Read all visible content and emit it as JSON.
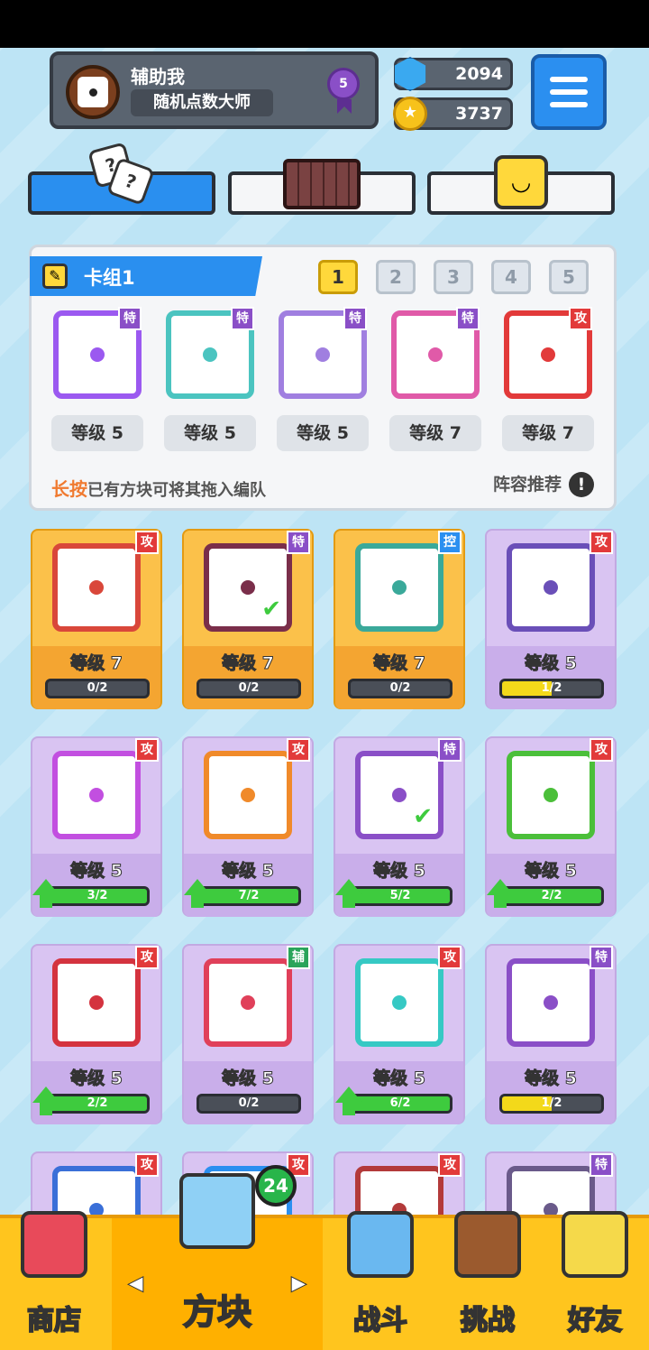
{
  "profile": {
    "name": "辅助我",
    "title": "随机点数大师",
    "rank": "5"
  },
  "currency": {
    "gems": "2094",
    "coins": "3737"
  },
  "deck": {
    "title": "卡组1",
    "pages": [
      "1",
      "2",
      "3",
      "4",
      "5"
    ],
    "active_page": "1",
    "slots": [
      {
        "tag": "特",
        "level": "等级 5",
        "color": "#9b59f0"
      },
      {
        "tag": "特",
        "level": "等级 5",
        "color": "#4bc4c0"
      },
      {
        "tag": "特",
        "level": "等级 5",
        "color": "#a07fe0"
      },
      {
        "tag": "特",
        "level": "等级 7",
        "color": "#e05aa8"
      },
      {
        "tag": "攻",
        "level": "等级 7",
        "color": "#e23a3a"
      }
    ],
    "hint_highlight": "长按",
    "hint_text": "已有方块可将其拖入编队",
    "recommend": "阵容推荐"
  },
  "collection": [
    {
      "tag": "攻",
      "level": "等级 7",
      "progress": "0/2",
      "fill": 0,
      "gold": true,
      "color": "#d9473a",
      "upgrade": false,
      "equipped": false
    },
    {
      "tag": "特",
      "level": "等级 7",
      "progress": "0/2",
      "fill": 0,
      "gold": true,
      "color": "#7a2e4a",
      "upgrade": false,
      "equipped": true
    },
    {
      "tag": "控",
      "level": "等级 7",
      "progress": "0/2",
      "fill": 0,
      "gold": true,
      "color": "#3aa99a",
      "upgrade": false,
      "equipped": false
    },
    {
      "tag": "攻",
      "level": "等级 5",
      "progress": "1/2",
      "fill": 0.5,
      "gold": false,
      "color": "#6a4fb8",
      "upgrade": false,
      "equipped": false,
      "yellow": true
    },
    {
      "tag": "攻",
      "level": "等级 5",
      "progress": "3/2",
      "fill": 1,
      "gold": false,
      "color": "#c24fe0",
      "upgrade": true,
      "equipped": false
    },
    {
      "tag": "攻",
      "level": "等级 5",
      "progress": "7/2",
      "fill": 1,
      "gold": false,
      "color": "#f08a2a",
      "upgrade": true,
      "equipped": false
    },
    {
      "tag": "特",
      "level": "等级 5",
      "progress": "5/2",
      "fill": 1,
      "gold": false,
      "color": "#8a4fc7",
      "upgrade": true,
      "equipped": true
    },
    {
      "tag": "攻",
      "level": "等级 5",
      "progress": "2/2",
      "fill": 1,
      "gold": false,
      "color": "#4bbf3a",
      "upgrade": true,
      "equipped": false
    },
    {
      "tag": "攻",
      "level": "等级 5",
      "progress": "2/2",
      "fill": 1,
      "gold": false,
      "color": "#d4333f",
      "upgrade": true,
      "equipped": false
    },
    {
      "tag": "辅",
      "level": "等级 5",
      "progress": "0/2",
      "fill": 0,
      "gold": false,
      "color": "#e0405a",
      "upgrade": false,
      "equipped": false
    },
    {
      "tag": "攻",
      "level": "等级 5",
      "progress": "6/2",
      "fill": 1,
      "gold": false,
      "color": "#36c9c4",
      "upgrade": true,
      "equipped": false
    },
    {
      "tag": "特",
      "level": "等级 5",
      "progress": "1/2",
      "fill": 0.5,
      "gold": false,
      "color": "#8a4fc7",
      "upgrade": false,
      "equipped": false,
      "yellow": true
    },
    {
      "tag": "攻",
      "level": "",
      "progress": "",
      "fill": 0,
      "gold": false,
      "color": "#3a6fd8",
      "upgrade": false,
      "equipped": false
    },
    {
      "tag": "攻",
      "level": "",
      "progress": "",
      "fill": 0,
      "gold": false,
      "color": "#2b8ff0",
      "upgrade": false,
      "equipped": false
    },
    {
      "tag": "攻",
      "level": "",
      "progress": "",
      "fill": 0,
      "gold": false,
      "color": "#b33a3a",
      "upgrade": false,
      "equipped": false
    },
    {
      "tag": "特",
      "level": "",
      "progress": "",
      "fill": 0,
      "gold": false,
      "color": "#6a5a8a",
      "upgrade": false,
      "equipped": false
    }
  ],
  "nav": {
    "shop": "商店",
    "blocks": "方块",
    "battle": "战斗",
    "challenge": "挑战",
    "friends": "好友",
    "blocks_badge": "24"
  },
  "colors": {
    "accent": "#2a8fef",
    "nav_bg": "#ffc51e",
    "attack": "#e23a3a",
    "special": "#8a4fc7"
  }
}
